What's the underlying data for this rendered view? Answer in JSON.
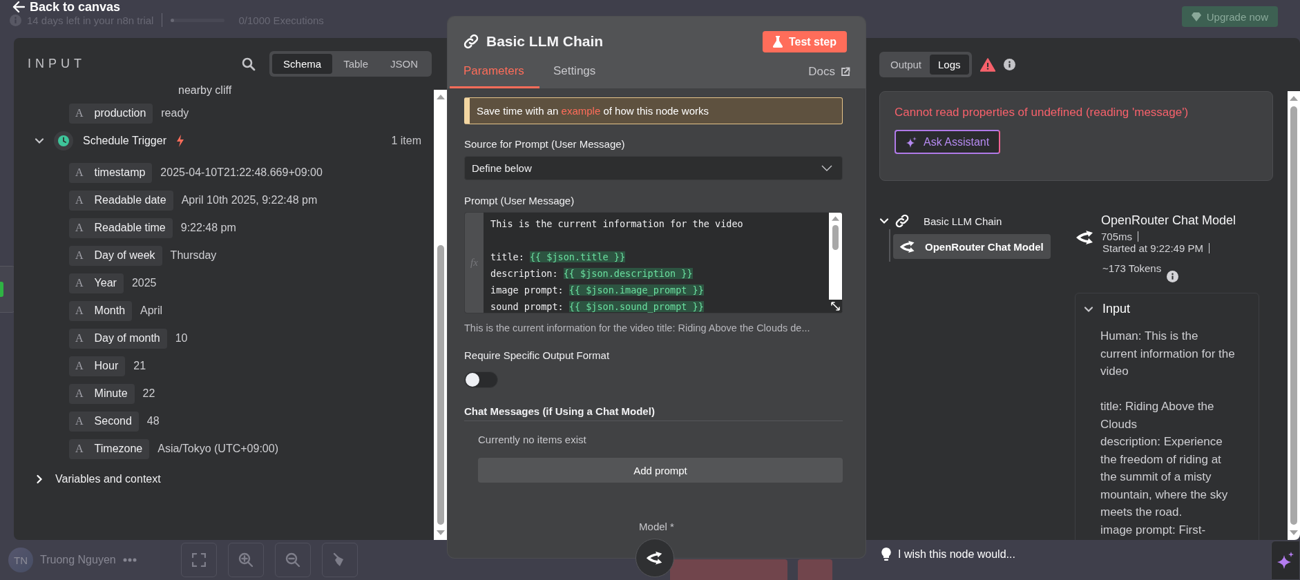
{
  "top_bar": {
    "back_link": "Back to canvas",
    "trial_text": "14 days left in your n8n trial",
    "executions": {
      "text": "0/1000 Executions",
      "level": 0
    },
    "upgrade_button": "Upgrade now"
  },
  "input_panel": {
    "title": "INPUT",
    "views": [
      {
        "label": "Schema",
        "selected": true
      },
      {
        "label": "Table",
        "selected": false
      },
      {
        "label": "JSON",
        "selected": false
      }
    ],
    "overflow_text": "nearby cliff",
    "fields": [
      {
        "type": "A",
        "name": "production",
        "value": "ready"
      }
    ],
    "nodes": [
      {
        "name": "Schedule Trigger",
        "count": "1 item",
        "expanded": true,
        "fields": [
          {
            "type": "A",
            "name": "timestamp",
            "value": "2025-04-10T21:22:48.669+09:00"
          },
          {
            "type": "A",
            "name": "Readable date",
            "value": "April 10th 2025, 9:22:48 pm"
          },
          {
            "type": "A",
            "name": "Readable time",
            "value": "9:22:48 pm"
          },
          {
            "type": "A",
            "name": "Day of week",
            "value": "Thursday"
          },
          {
            "type": "A",
            "name": "Year",
            "value": "2025"
          },
          {
            "type": "A",
            "name": "Month",
            "value": "April"
          },
          {
            "type": "A",
            "name": "Day of month",
            "value": "10"
          },
          {
            "type": "A",
            "name": "Hour",
            "value": "21"
          },
          {
            "type": "A",
            "name": "Minute",
            "value": "22"
          },
          {
            "type": "A",
            "name": "Second",
            "value": "48"
          },
          {
            "type": "A",
            "name": "Timezone",
            "value": "Asia/Tokyo (UTC+09:00)"
          }
        ]
      }
    ],
    "sections": [
      {
        "label": "Variables and context",
        "expanded": false
      }
    ]
  },
  "node_panel": {
    "title": "Basic LLM Chain",
    "test_button": "Test step",
    "tabs": [
      {
        "label": "Parameters",
        "selected": true
      },
      {
        "label": "Settings",
        "selected": false
      }
    ],
    "docs_link": "Docs",
    "callout": {
      "before": "Save time with an ",
      "link": "example",
      "after": " of how this node works"
    },
    "params": [
      {
        "kind": "select",
        "label": "Source for Prompt (User Message)",
        "value": "Define below"
      },
      {
        "kind": "code",
        "label": "Prompt (User Message)",
        "gutter_label": "fx",
        "lines": [
          {
            "parts": [
              {
                "kind": "plain",
                "text": "This is the current information for the video"
              }
            ]
          },
          {
            "gap_before": true,
            "parts": [
              {
                "kind": "plain",
                "text": "title: "
              },
              {
                "kind": "expression",
                "text": "{{ $json.title }}"
              }
            ]
          },
          {
            "parts": [
              {
                "kind": "plain",
                "text": "description: "
              },
              {
                "kind": "expression",
                "text": "{{ $json.description }}"
              }
            ]
          },
          {
            "parts": [
              {
                "kind": "plain",
                "text": "image prompt: "
              },
              {
                "kind": "expression",
                "text": "{{ $json.image_prompt }}"
              }
            ]
          },
          {
            "parts": [
              {
                "kind": "plain",
                "text": "sound prompt: "
              },
              {
                "kind": "expression",
                "text": "{{ $json.sound_prompt }}"
              }
            ]
          }
        ],
        "preview": "This is the current information for the video title: Riding Above the Clouds de..."
      },
      {
        "kind": "toggle",
        "label": "Require Specific Output Format",
        "on": false
      },
      {
        "kind": "collection",
        "label": "Chat Messages (if Using a Chat Model)",
        "empty_text": "Currently no items exist",
        "button": "Add prompt"
      }
    ],
    "model_label": "Model *"
  },
  "output_panel": {
    "tabs": [
      {
        "label": "Output",
        "selected": false
      },
      {
        "label": "Logs",
        "selected": true
      }
    ],
    "error": {
      "message": "Cannot read properties of undefined (reading 'message')",
      "button": "Ask Assistant"
    },
    "log_tree": [
      {
        "name": "Basic LLM Chain",
        "expanded": true,
        "children": [
          {
            "name": "OpenRouter Chat Model",
            "selected": true
          }
        ]
      }
    ],
    "log_detail": {
      "title": "OpenRouter Chat Model",
      "duration": "705ms",
      "started": "Started at 9:22:49 PM",
      "tokens": "~173 Tokens",
      "input": {
        "label": "Input",
        "expanded": true,
        "text": "Human: This is the current information for the video\n\ntitle: Riding Above the Clouds\ndescription: Experience the freedom of riding at the summit of a misty mountain, where the sky meets the road.\nimage prompt: First-"
      }
    }
  },
  "footer": {
    "user": {
      "initials": "TN",
      "name": "Truong Nguyen"
    },
    "feedback": "I wish this node would..."
  }
}
